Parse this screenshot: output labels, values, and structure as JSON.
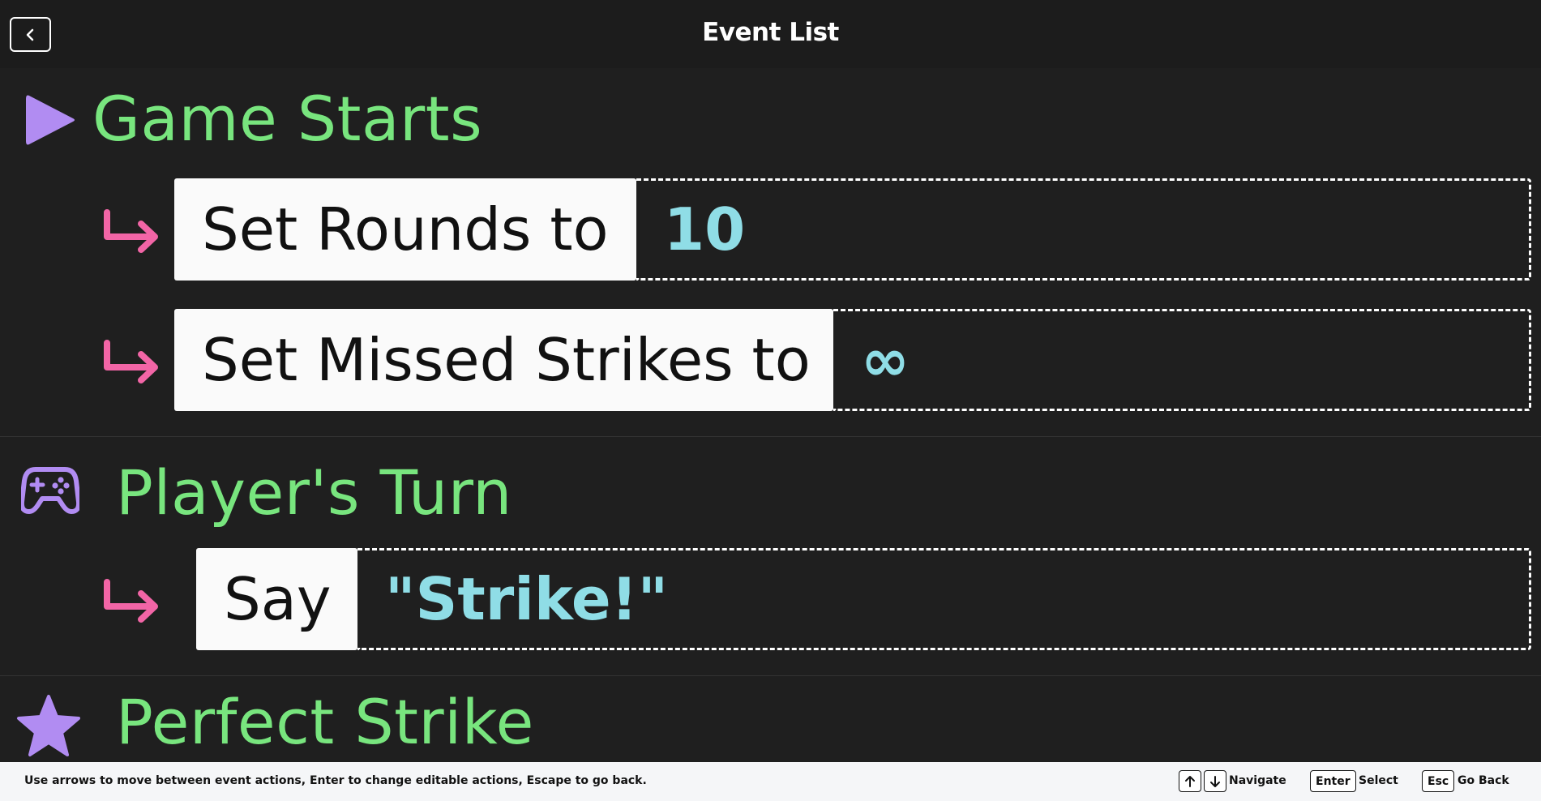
{
  "header": {
    "title": "Event List",
    "back_icon": "chevron-left-icon"
  },
  "events": [
    {
      "icon": "play-icon",
      "title": "Game Starts",
      "actions": [
        {
          "label": "Set Rounds to",
          "value": "10"
        },
        {
          "label": "Set Missed Strikes to",
          "value": "∞"
        }
      ]
    },
    {
      "icon": "gamepad-icon",
      "title": "Player's Turn",
      "actions": [
        {
          "label": "Say",
          "value": "\"Strike!\""
        }
      ]
    },
    {
      "icon": "star-icon",
      "title": "Perfect Strike",
      "actions": []
    }
  ],
  "colors": {
    "background": "#1f1f1f",
    "event_title": "#78e57e",
    "icon_purple": "#b18cf2",
    "arrow_pink": "#f265a6",
    "value_cyan": "#8fdde6"
  },
  "footer": {
    "hint": "Use arrows to move between event actions, Enter to change editable actions, Escape to go back.",
    "navigate_label": "Navigate",
    "enter_key": "Enter",
    "select_label": "Select",
    "esc_key": "Esc",
    "go_back_label": "Go Back"
  }
}
